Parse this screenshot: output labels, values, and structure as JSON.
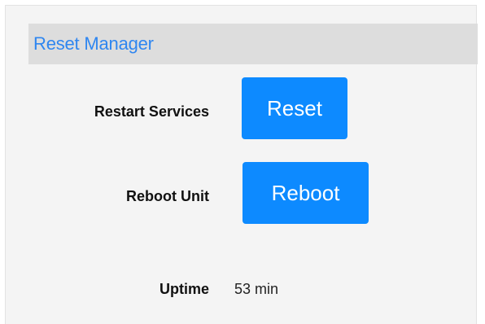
{
  "panel": {
    "title": "Reset Manager"
  },
  "rows": {
    "restart": {
      "label": "Restart Services",
      "button_label": "Reset"
    },
    "reboot": {
      "label": "Reboot Unit",
      "button_label": "Reboot"
    },
    "uptime": {
      "label": "Uptime",
      "value": "53 min"
    }
  },
  "colors": {
    "accent": "#0d8aff",
    "title": "#2f86f0",
    "header_bg": "#dddddd",
    "panel_bg": "#f4f4f4"
  }
}
